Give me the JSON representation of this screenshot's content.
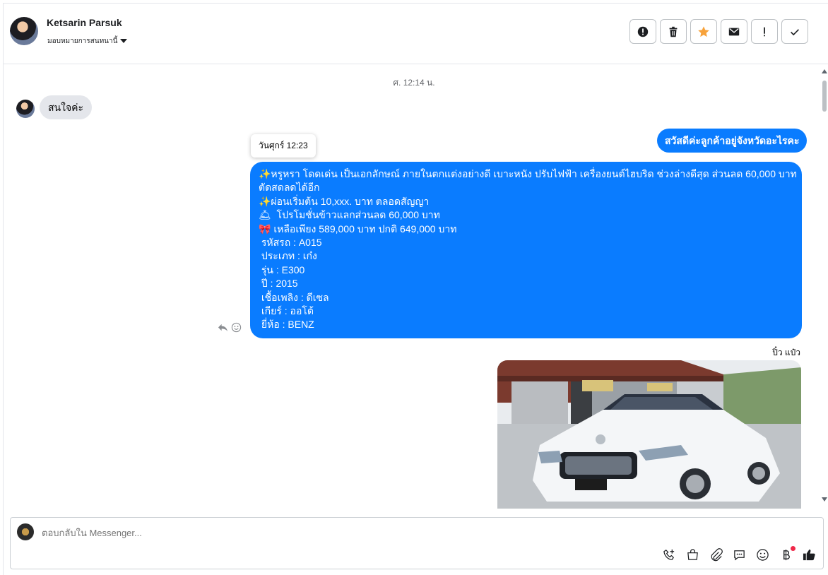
{
  "header": {
    "contact_name": "Ketsarin Parsuk",
    "assign_label": "มอบหมายการสนทนานี้",
    "actions": [
      {
        "name": "spam-button",
        "icon": "alert-circle-icon"
      },
      {
        "name": "delete-button",
        "icon": "trash-icon"
      },
      {
        "name": "star-button",
        "icon": "star-icon",
        "color": "#f7a23b"
      },
      {
        "name": "mark-unread-button",
        "icon": "envelope-icon"
      },
      {
        "name": "follow-up-button",
        "icon": "exclamation-icon"
      },
      {
        "name": "mark-done-button",
        "icon": "check-icon"
      }
    ]
  },
  "conversation": {
    "timestamp": "ศ. 12:14 น.",
    "incoming_message": "สนใจค่ะ",
    "tooltip": "วันศุกร์ 12:23",
    "outgoing_greeting": "สวัสดีค่ะลูกค้าอยู่จังหวัดอะไรคะ",
    "listing_lines": [
      "✨หรูหรา โดดเด่น เป็นเอกลักษณ์ ภายในตกแต่งอย่างดี เบาะหนัง ปรับไฟฟ้า เครื่องยนต์ไฮบริด ช่วงล่างดีสุด ส่วนลด 60,000 บาท",
      "ตัดสดลดได้อีก",
      "✨ผ่อนเริ่มต้น 10,xxx. บาท ตลอดสัญญา",
      "🛎  โปรโมชั่นข้าวแลกส่วนลด 60,000 บาท",
      "🎀 เหลือเพียง 589,000 บาท ปกติ 649,000 บาท",
      " รหัสรถ : A015",
      " ประเภท : เก๋ง",
      " รุ่น : E300",
      " ปี : 2015",
      " เชื้อเพลิง : ดีเซล",
      " เกียร์ : ออโต้",
      " ยี่ห้อ : BENZ"
    ],
    "sender_name": "ปิ๋ว แป๋ว",
    "accent_color": "#0a7cff"
  },
  "composer": {
    "placeholder": "ตอบกลับใน Messenger...",
    "tools": [
      "phone-plus-icon",
      "shopping-bag-icon",
      "paperclip-icon",
      "saved-reply-icon",
      "emoji-icon",
      "baht-icon",
      "thumbs-up-icon"
    ]
  }
}
